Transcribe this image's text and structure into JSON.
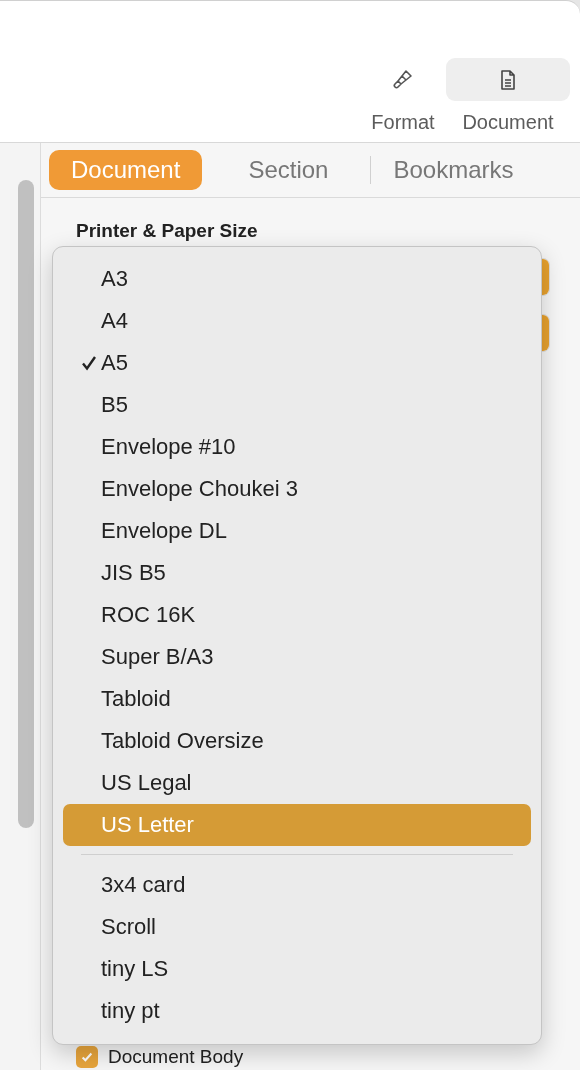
{
  "toolbar": {
    "buttons": [
      {
        "label": "Format",
        "selected": false
      },
      {
        "label": "Document",
        "selected": true
      }
    ]
  },
  "inspector": {
    "tabs": [
      {
        "label": "Document",
        "selected": true
      },
      {
        "label": "Section",
        "selected": false
      },
      {
        "label": "Bookmarks",
        "selected": false
      }
    ],
    "section_title": "Printer & Paper Size",
    "checkbox": {
      "label": "Document Body",
      "checked": true
    }
  },
  "paper_size_menu": {
    "groups": [
      [
        {
          "label": "A3",
          "checked": false,
          "highlighted": false
        },
        {
          "label": "A4",
          "checked": false,
          "highlighted": false
        },
        {
          "label": "A5",
          "checked": true,
          "highlighted": false
        },
        {
          "label": "B5",
          "checked": false,
          "highlighted": false
        },
        {
          "label": "Envelope #10",
          "checked": false,
          "highlighted": false
        },
        {
          "label": "Envelope Choukei 3",
          "checked": false,
          "highlighted": false
        },
        {
          "label": "Envelope DL",
          "checked": false,
          "highlighted": false
        },
        {
          "label": "JIS B5",
          "checked": false,
          "highlighted": false
        },
        {
          "label": "ROC 16K",
          "checked": false,
          "highlighted": false
        },
        {
          "label": "Super B/A3",
          "checked": false,
          "highlighted": false
        },
        {
          "label": "Tabloid",
          "checked": false,
          "highlighted": false
        },
        {
          "label": "Tabloid Oversize",
          "checked": false,
          "highlighted": false
        },
        {
          "label": "US Legal",
          "checked": false,
          "highlighted": false
        },
        {
          "label": "US Letter",
          "checked": false,
          "highlighted": true
        }
      ],
      [
        {
          "label": "3x4 card",
          "checked": false,
          "highlighted": false
        },
        {
          "label": "Scroll",
          "checked": false,
          "highlighted": false
        },
        {
          "label": "tiny LS",
          "checked": false,
          "highlighted": false
        },
        {
          "label": "tiny pt",
          "checked": false,
          "highlighted": false
        }
      ]
    ]
  }
}
